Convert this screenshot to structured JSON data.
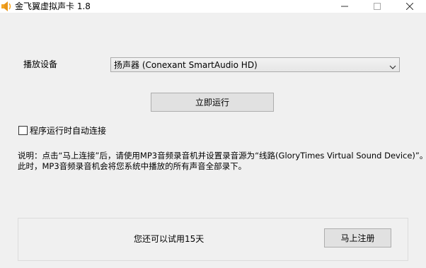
{
  "window": {
    "title": "金飞翼虚拟声卡 1.8"
  },
  "device": {
    "label": "播放设备",
    "selected": "扬声器 (Conexant SmartAudio HD)"
  },
  "run_button_label": "立即运行",
  "autoconnect": {
    "label": "程序运行时自动连接",
    "checked": false
  },
  "instructions": {
    "line1": "说明：点击“马上连接”后，请使用MP3音频录音机并设置录音源为“线路(GloryTimes Virtual Sound Device)”。",
    "line2": "此时，MP3音频录音机会将您系统中播放的所有声音全部录下。"
  },
  "footer": {
    "trial_text": "您还可以试用15天",
    "register_button_label": "马上注册"
  },
  "colors": {
    "icon_orange": "#f5a623",
    "window_bg": "#f0f0f0",
    "button_bg": "#e1e1e1",
    "button_border": "#adadad"
  }
}
